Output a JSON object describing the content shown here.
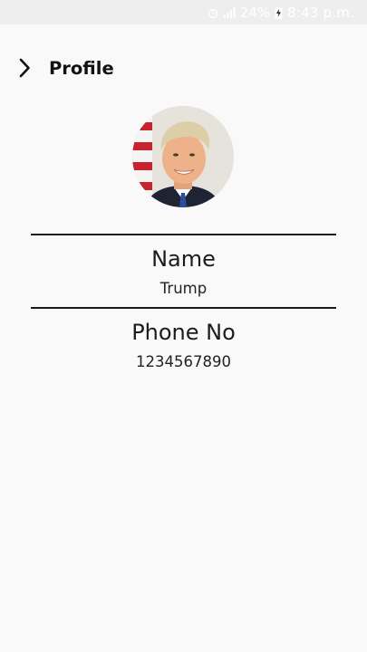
{
  "status_bar": {
    "battery_percent": "24%",
    "time": "8:43 p.m.",
    "icons": [
      "alarm-icon",
      "signal-icon",
      "battery-charging-icon"
    ]
  },
  "app_bar": {
    "back_icon": "chevron-right-icon",
    "title": "Profile"
  },
  "profile": {
    "avatar_icon": "profile-photo",
    "name_label": "Name",
    "name_value": "Trump",
    "phone_label": "Phone No",
    "phone_value": "1234567890"
  },
  "colors": {
    "background": "#f9f9f9",
    "status_bar": "#eeeeee",
    "divider": "#1a1a1a",
    "text": "#111111"
  }
}
